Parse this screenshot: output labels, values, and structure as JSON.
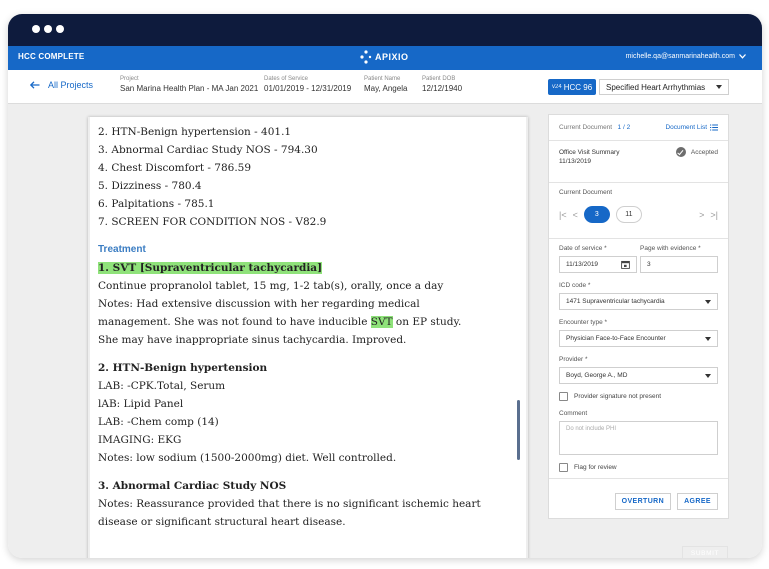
{
  "app": {
    "name": "HCC COMPLETE",
    "logo_text": "APIXIO",
    "user_email": "michelle.qa@sanmarinahealth.com"
  },
  "header": {
    "back_label": "All Projects",
    "project": {
      "key": "Project",
      "value": "San Marina Health Plan - MA Jan 2021"
    },
    "dates": {
      "key": "Dates of Service",
      "value": "01/01/2019 - 12/31/2019"
    },
    "patient": {
      "key": "Patient Name",
      "value": "May, Angela"
    },
    "dob": {
      "key": "Patient DOB",
      "value": "12/12/1940"
    },
    "hcc_version": "v24",
    "hcc_code": "HCC 96",
    "hcc_select_value": "Specified Heart Arrhythmias"
  },
  "document": {
    "lines_top": [
      "2. HTN-Benign hypertension - 401.1",
      "3. Abnormal Cardiac Study NOS - 794.30",
      "4. Chest Discomfort - 786.59",
      "5. Dizziness - 780.4",
      "6. Palpitations - 785.1",
      "7. SCREEN FOR CONDITION NOS - V82.9"
    ],
    "treatment_heading": "Treatment",
    "svt_heading": "1. SVT [Supraventricular tachycardia]",
    "svt_lines": [
      "Continue propranolol tablet, 15 mg, 1-2 tab(s), orally, once a day",
      "Notes: Had extensive discussion with her regarding medical",
      "management. She was not found to have inducible",
      "SVT",
      "on EP study.",
      "She may have inappropriate sinus tachycardia. Improved."
    ],
    "htn_heading": "2. HTN-Benign hypertension",
    "htn_lines": [
      "LAB: -CPK.Total, Serum",
      "lAB: Lipid Panel",
      "LAB: -Chem comp (14)",
      "IMAGING: EKG",
      "Notes: low sodium (1500-2000mg) diet. Well controlled."
    ],
    "acs_heading": "3. Abnormal Cardiac Study NOS",
    "acs_lines": [
      "Notes: Reassurance provided that there is no significant ischemic heart",
      "disease or significant structural heart disease."
    ]
  },
  "panel": {
    "current_document_label": "Current Document",
    "current_index": "1",
    "separator": "/",
    "total": "2",
    "document_list_label": "Document List",
    "doc_title": "Office Visit Summary",
    "doc_date": "11/13/2019",
    "accepted_label": "Accepted",
    "current_document_label2": "Current Document",
    "pages": [
      "3",
      "11"
    ],
    "date_of_service_label": "Date of service *",
    "date_of_service_value": "11/13/2019",
    "page_evidence_label": "Page with evidence *",
    "page_evidence_value": "3",
    "icd_label": "ICD code *",
    "icd_value": "1471 Supraventricular tachycardia",
    "encounter_label": "Encounter type *",
    "encounter_value": "Physician Face-to-Face Encounter",
    "provider_label": "Provider *",
    "provider_value": "Boyd, George A., MD",
    "sig_label": "Provider signature not present",
    "comment_label": "Comment",
    "comment_placeholder": "Do not include PHI",
    "flag_label": "Flag for review",
    "overturn_label": "OVERTURN",
    "agree_label": "AGREE",
    "submit_label": "SUBMIT"
  },
  "colors": {
    "brand_blue": "#1668c7",
    "title_bar": "#0e1b3d",
    "highlight": "#8fe27a",
    "treatment": "#3a7cc2"
  },
  "icons": [
    "back-arrow-icon",
    "logo-icon",
    "chevron-down-icon",
    "list-icon",
    "check-circle-icon",
    "calendar-icon",
    "first-page-icon",
    "prev-page-icon",
    "next-page-icon",
    "last-page-icon"
  ]
}
